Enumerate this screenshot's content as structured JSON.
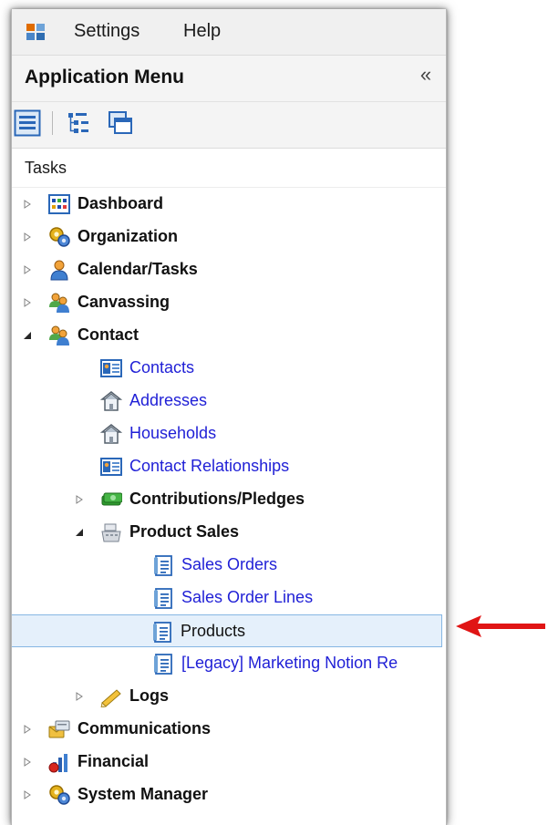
{
  "menubar": {
    "items": [
      {
        "label": "Settings"
      },
      {
        "label": "Help"
      }
    ]
  },
  "app_menu": {
    "title": "Application Menu",
    "collapse_glyph": "«"
  },
  "toolbar": {
    "buttons": [
      {
        "icon": "list-view-icon"
      },
      {
        "icon": "tree-view-icon"
      },
      {
        "icon": "windows-icon"
      }
    ]
  },
  "tasks": {
    "label": "Tasks"
  },
  "tree": {
    "items": [
      {
        "label": "Dashboard",
        "icon": "dashboard-icon",
        "expander": "collapsed",
        "style": "bold",
        "level": 0
      },
      {
        "label": "Organization",
        "icon": "gears-icon",
        "expander": "collapsed",
        "style": "bold",
        "level": 0
      },
      {
        "label": "Calendar/Tasks",
        "icon": "person-icon",
        "expander": "collapsed",
        "style": "bold",
        "level": 0
      },
      {
        "label": "Canvassing",
        "icon": "people-icon",
        "expander": "collapsed",
        "style": "bold",
        "level": 0
      },
      {
        "label": "Contact",
        "icon": "people-icon",
        "expander": "expanded",
        "style": "bold",
        "level": 0
      },
      {
        "label": "Contacts",
        "icon": "contact-card-icon",
        "expander": "none",
        "style": "link",
        "level": 1
      },
      {
        "label": "Addresses",
        "icon": "house-icon",
        "expander": "none",
        "style": "link",
        "level": 1
      },
      {
        "label": "Households",
        "icon": "house-icon",
        "expander": "none",
        "style": "link",
        "level": 1
      },
      {
        "label": "Contact Relationships",
        "icon": "contact-card-icon",
        "expander": "none",
        "style": "link",
        "level": 1
      },
      {
        "label": "Contributions/Pledges",
        "icon": "money-icon",
        "expander": "collapsed",
        "style": "bold",
        "level": 1
      },
      {
        "label": "Product Sales",
        "icon": "cash-register-icon",
        "expander": "expanded",
        "style": "bold",
        "level": 1
      },
      {
        "label": "Sales Orders",
        "icon": "document-list-icon",
        "expander": "none",
        "style": "link",
        "level": 2
      },
      {
        "label": "Sales Order Lines",
        "icon": "document-list-icon",
        "expander": "none",
        "style": "link",
        "level": 2
      },
      {
        "label": "Products",
        "icon": "document-list-icon",
        "expander": "none",
        "style": "selected",
        "level": 2
      },
      {
        "label": "[Legacy] Marketing Notion Re",
        "icon": "document-list-icon",
        "expander": "none",
        "style": "link",
        "level": 2
      },
      {
        "label": "Logs",
        "icon": "pencil-icon",
        "expander": "collapsed",
        "style": "bold",
        "level": 1
      },
      {
        "label": "Communications",
        "icon": "communications-icon",
        "expander": "collapsed",
        "style": "bold",
        "level": 0
      },
      {
        "label": "Financial",
        "icon": "financial-icon",
        "expander": "collapsed",
        "style": "bold",
        "level": 0
      },
      {
        "label": "System Manager",
        "icon": "gears-icon",
        "expander": "collapsed",
        "style": "bold",
        "level": 0
      }
    ]
  },
  "annotation": {
    "icon": "red-arrow-icon",
    "color": "#e01515"
  },
  "colors": {
    "link": "#1f1fd6",
    "selection_bg": "#e5f0fb",
    "selection_border": "#86b6e3"
  }
}
